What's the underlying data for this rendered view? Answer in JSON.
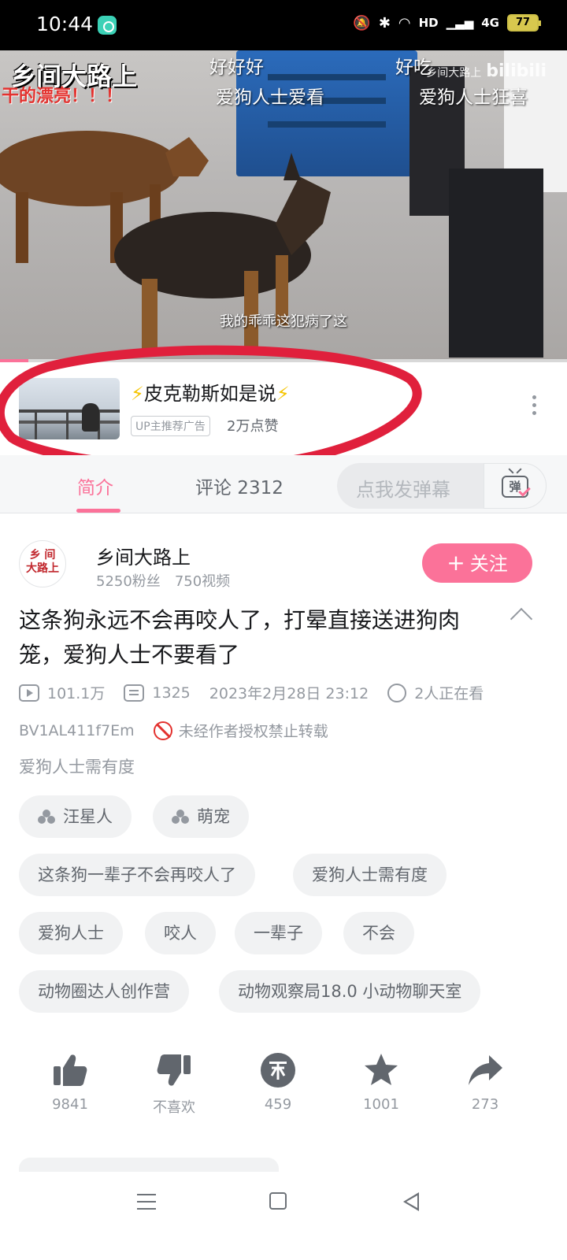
{
  "status_bar": {
    "time": "10:44",
    "battery": "77",
    "network": "4G"
  },
  "video": {
    "watermark_title": "乡间大路上",
    "bili_watermark": "乡间大路上",
    "bili_logo": "bilibili",
    "danmaku": [
      "好好好",
      "爱狗人士爱看",
      "好吃",
      "爱狗人士狂喜",
      "干的漂亮！！！"
    ],
    "subtitle": "我的乖乖这犯病了这",
    "progress": 0.05
  },
  "ad": {
    "title": "皮克勒斯如是说",
    "tag": "UP主推荐广告",
    "likes": "2万点赞"
  },
  "tabs": {
    "intro": "简介",
    "comments": "评论 2312",
    "danmaku_placeholder": "点我发弹幕",
    "danmaku_button": "弹"
  },
  "uploader": {
    "avatar_text_1": "乡 间",
    "avatar_text_2": "大路上",
    "name": "乡间大路上",
    "fans": "5250粉丝",
    "videos": "750视频",
    "follow_plus": "+",
    "follow_label": "关注"
  },
  "video_info": {
    "title": "这条狗永远不会再咬人了，打晕直接送进狗肉笼，爱狗人士不要看了",
    "views": "101.1万",
    "danmaku_count": "1325",
    "date": "2023年2月28日 23:12",
    "watching": "2人正在看",
    "bvid": "BV1AL411f7Em",
    "copyright": "未经作者授权禁止转载",
    "description": "爱狗人士需有度"
  },
  "tags": [
    {
      "label": "汪星人",
      "icon": "channel-icon"
    },
    {
      "label": "萌宠",
      "icon": "channel-icon"
    },
    {
      "label": "这条狗一辈子不会再咬人了"
    },
    {
      "label": "爱狗人士需有度"
    },
    {
      "label": "爱狗人士"
    },
    {
      "label": "咬人"
    },
    {
      "label": "一辈子"
    },
    {
      "label": "不会"
    },
    {
      "label": "动物圈达人创作营"
    },
    {
      "label": "动物观察局18.0 小动物聊天室"
    }
  ],
  "actions": {
    "like": "9841",
    "dislike": "不喜欢",
    "coin": "459",
    "favorite": "1001",
    "share": "273"
  },
  "colors": {
    "accent": "#fb7299",
    "annotation_red": "#e0203c"
  }
}
